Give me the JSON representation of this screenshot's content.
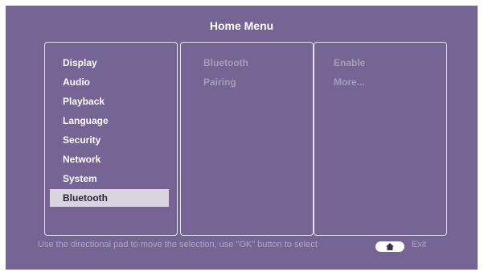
{
  "colors": {
    "background": "#766494",
    "selected_background": "#d8d4e0",
    "selected_text": "#2b2238",
    "dim_text": "#a89bbc",
    "panel_border": "#e6e1ee"
  },
  "header": {
    "title": "Home Menu"
  },
  "main_menu": {
    "items": [
      {
        "label": "Display"
      },
      {
        "label": "Audio"
      },
      {
        "label": "Playback"
      },
      {
        "label": "Language"
      },
      {
        "label": "Security"
      },
      {
        "label": "Network"
      },
      {
        "label": "System"
      },
      {
        "label": "Bluetooth"
      }
    ],
    "selected_label": "Bluetooth"
  },
  "submenu": {
    "items": [
      {
        "label": "Bluetooth"
      },
      {
        "label": "Pairing"
      }
    ]
  },
  "options": {
    "items": [
      {
        "label": "Enable"
      },
      {
        "label": "More..."
      }
    ]
  },
  "footer": {
    "hint": "Use the directional pad to move the selection, use \"OK\" button to select",
    "home_icon": "home-icon",
    "exit_label": "Exit"
  }
}
